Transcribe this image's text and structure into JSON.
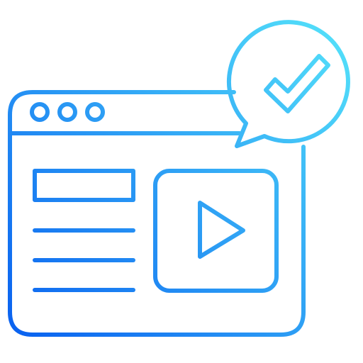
{
  "icon": {
    "name": "web-video-approved-icon",
    "parts": [
      "browser-window-icon",
      "window-control-dots",
      "heading-block",
      "text-lines",
      "video-player-icon",
      "play-icon",
      "speech-bubble-icon",
      "checkmark-icon"
    ]
  },
  "colors": {
    "gradient_start": "#0A62F0",
    "gradient_end": "#55E3FA",
    "background": "#FFFFFF"
  }
}
